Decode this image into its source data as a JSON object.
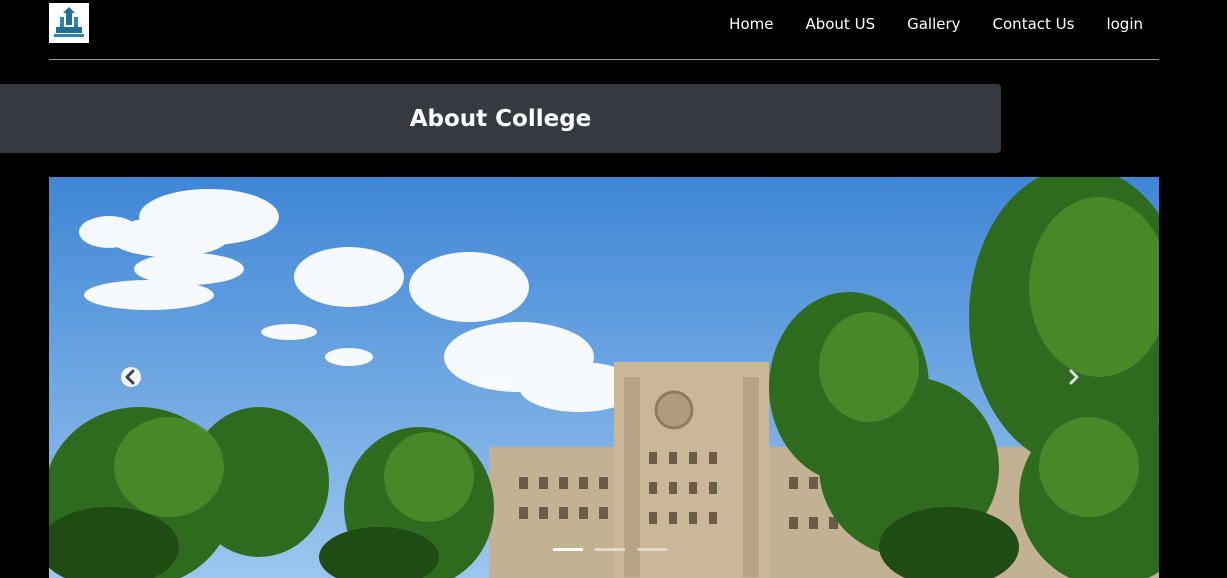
{
  "brand": {
    "logo_icon": "university-logo-icon"
  },
  "nav": {
    "items": [
      {
        "label": "Home"
      },
      {
        "label": "About US"
      },
      {
        "label": "Gallery"
      },
      {
        "label": "Contact Us"
      },
      {
        "label": "login"
      }
    ]
  },
  "banner": {
    "title": "About College"
  },
  "carousel": {
    "prev_icon": "chevron-left-icon",
    "next_icon": "chevron-right-icon",
    "slide_count": 3,
    "active_slide": 1
  },
  "colors": {
    "page_background": "#000000",
    "banner_background": "#343a40",
    "nav_text": "#ffffff"
  }
}
